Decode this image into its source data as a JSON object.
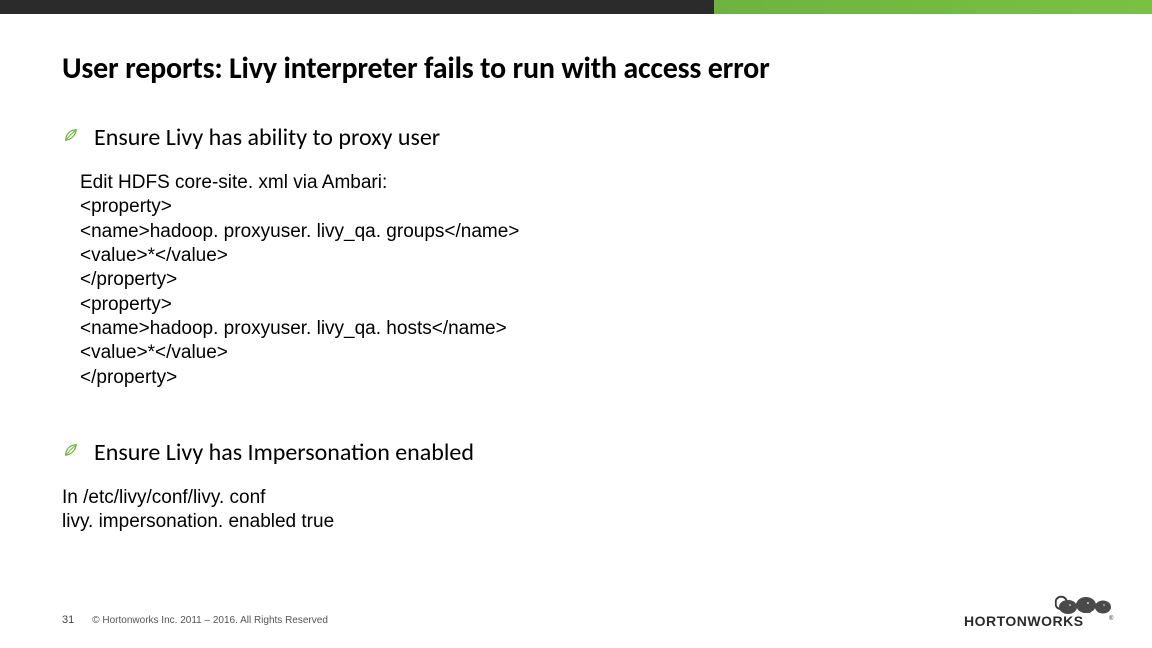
{
  "title": "User reports: Livy interpreter fails to run with access error",
  "bullets": {
    "b1": "Ensure Livy has ability to proxy user",
    "b2": "Ensure Livy has Impersonation enabled"
  },
  "code1": {
    "l0": "Edit HDFS core-site. xml via Ambari:",
    "l1": "<property>",
    "l2": "<name>hadoop. proxyuser. livy_qa. groups</name>",
    "l3": "<value>*</value>",
    "l4": "</property>",
    "l5": "<property>",
    "l6": "<name>hadoop. proxyuser. livy_qa. hosts</name>",
    "l7": "<value>*</value>",
    "l8": "</property>"
  },
  "code2": {
    "l0": "In /etc/livy/conf/livy. conf",
    "l1": "livy. impersonation. enabled true"
  },
  "footer": {
    "page": "31",
    "copyright": "© Hortonworks Inc. 2011 – 2016. All Rights Reserved"
  },
  "logo": {
    "brand": "HORTONWORKS"
  }
}
